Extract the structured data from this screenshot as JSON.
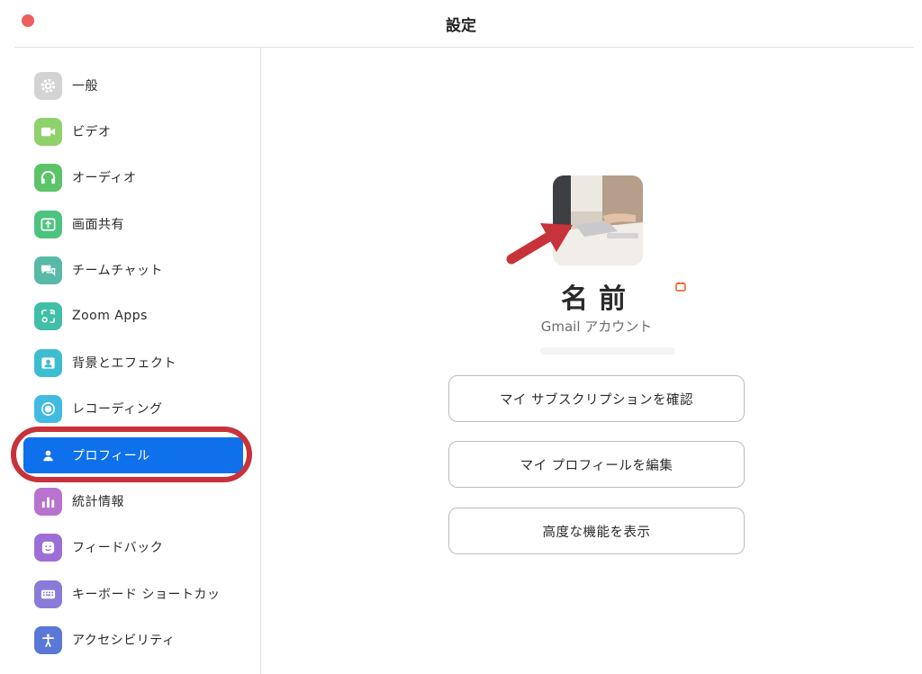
{
  "window": {
    "title": "設定"
  },
  "sidebar": {
    "items": [
      {
        "label": "一般",
        "icon": "gear-icon",
        "color": "#d3d3d3"
      },
      {
        "label": "ビデオ",
        "icon": "video-camera-icon",
        "color": "#8fd16a"
      },
      {
        "label": "オーディオ",
        "icon": "headphones-icon",
        "color": "#5cc468"
      },
      {
        "label": "画面共有",
        "icon": "share-screen-icon",
        "color": "#4cc37f"
      },
      {
        "label": "チームチャット",
        "icon": "chat-bubble-icon",
        "color": "#58b9a7"
      },
      {
        "label": "Zoom Apps",
        "icon": "apps-icon",
        "color": "#40bfa6"
      },
      {
        "label": "背景とエフェクト",
        "icon": "person-background-icon",
        "color": "#3dbdd0"
      },
      {
        "label": "レコーディング",
        "icon": "record-icon",
        "color": "#41bce0"
      },
      {
        "label": "プロフィール",
        "icon": "user-icon",
        "color": "#0e71eb",
        "active": true
      },
      {
        "label": "統計情報",
        "icon": "bar-chart-icon",
        "color": "#b873cf"
      },
      {
        "label": "フィードバック",
        "icon": "smiley-icon",
        "color": "#9c6fd6"
      },
      {
        "label": "キーボード ショートカッ",
        "icon": "keyboard-icon",
        "color": "#8b7bd8"
      },
      {
        "label": "アクセシビリティ",
        "icon": "accessibility-icon",
        "color": "#5a78d8"
      }
    ]
  },
  "profile": {
    "name": "名前",
    "account_label": "Gmail アカウント"
  },
  "actions": {
    "subscription": "マイ サブスクリプションを確認",
    "edit_profile": "マイ プロフィールを編集",
    "advanced": "高度な機能を表示"
  },
  "colors": {
    "accent": "#0e71eb",
    "annotation": "#c8323a",
    "close_button": "#ec5f5a"
  }
}
